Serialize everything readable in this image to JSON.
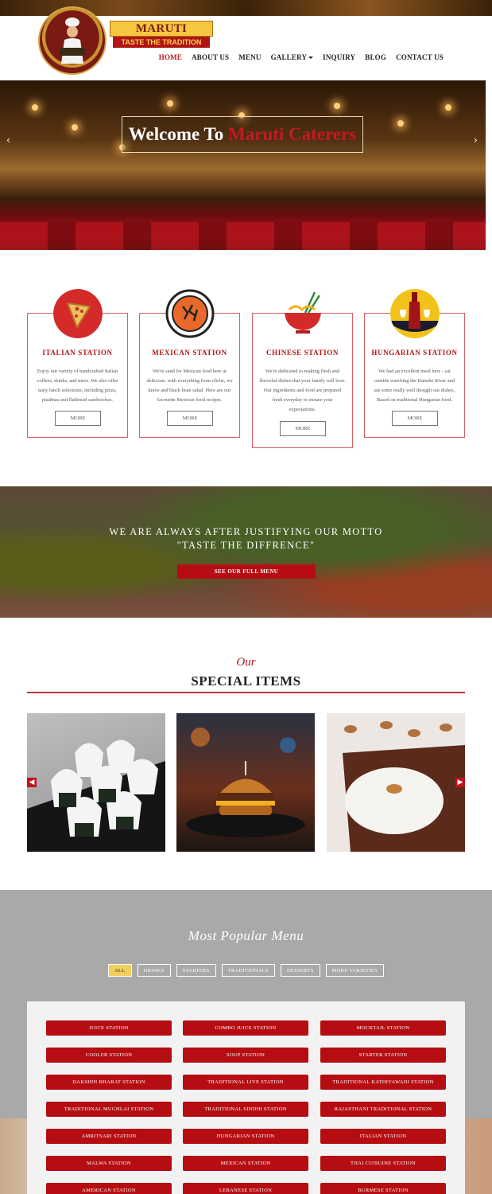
{
  "brand": {
    "name": "MARUTI CATERERS",
    "tagline": "TASTE THE TRADITION"
  },
  "nav": {
    "items": [
      {
        "label": "HOME",
        "active": true
      },
      {
        "label": "ABOUT US"
      },
      {
        "label": "MENU"
      },
      {
        "label": "GALLERY",
        "dropdown": true
      },
      {
        "label": "INQUIRY"
      },
      {
        "label": "BLOG"
      },
      {
        "label": "CONTACT US"
      }
    ]
  },
  "hero": {
    "welcome": "Welcome To",
    "brand": "Maruti Caterers",
    "prev_icon": "chevron-left",
    "next_icon": "chevron-right"
  },
  "stations": [
    {
      "title": "ITALIAN STATION",
      "icon": "pizza-icon",
      "text": "Enjoy our variety of handcrafted Italian coffees, drinks, and more. We also offer tasty lunch selections, including pizza, piadinas and flatbread sandwiches.",
      "button": "MORE"
    },
    {
      "title": "MEXICAN STATION",
      "icon": "mexican-dish-icon",
      "text": "We're sand for Mexican food here at delicious. with everything from cliche, we know and black bean salad. Here are our favourite Mexican food recipes.",
      "button": "MORE"
    },
    {
      "title": "CHINESE STATION",
      "icon": "noodle-bowl-icon",
      "text": "We're dedicated to making fresh and flavorful dishes that your family will love. Our ingredients and food are prepared fresh everyday to ensure your expectations.",
      "button": "MORE"
    },
    {
      "title": "HUNGARIAN STATION",
      "icon": "wine-icon",
      "text": "We had an excellent meal here - sat outside watching the Danube River and ate some really well thought out dishes, Based on traditional Hungarian food.",
      "button": "MORE"
    }
  ],
  "motto": {
    "line1": "WE ARE ALWAYS AFTER JUSTIFYING OUR MOTTO",
    "line2": "\"TASTE THE DIFFRENCE\"",
    "button": "SEE OUR FULL MENU"
  },
  "special": {
    "kicker": "Our",
    "title": "SPECIAL ITEMS",
    "items": [
      "onigiri-image",
      "burger-image",
      "dessert-image"
    ]
  },
  "popular": {
    "title": "Most Popular Menu",
    "filters": [
      {
        "label": "ALL",
        "active": true
      },
      {
        "label": "DRINKS"
      },
      {
        "label": "STARTERS"
      },
      {
        "label": "TRADITIONALS"
      },
      {
        "label": "DESSERTS"
      },
      {
        "label": "MORE VARIETIES"
      }
    ],
    "items": [
      "JUICE STATION",
      "COMBO JUICE STATION",
      "MOCKTAIL STATION",
      "COOLER STATION",
      "SOUP STATION",
      "STARTER STATION",
      "DAKSHIN BHARAT STATION",
      "TRADITIONAL LIVE STATION",
      "TRADITIONAL KATHIYAWADI STATION",
      "TRADITIONAL MUGHLAI STATION",
      "TRADITIONAL SINDHI STATION",
      "RAJASTHANI TRADITIONAL STATION",
      "AMRITSARI STATION",
      "HUNGARIAN STATION",
      "ITALIAN STATION",
      "MALWA STATION",
      "MEXICAN STATION",
      "THAI CUISUINE STATION",
      "AMERICAN STATION",
      "LEBANESE STATION",
      "BURMESE STATION"
    ]
  },
  "colors": {
    "accent": "#b50d12",
    "brand_gold": "#f7c640",
    "filter_active": "#f2cf5b"
  }
}
